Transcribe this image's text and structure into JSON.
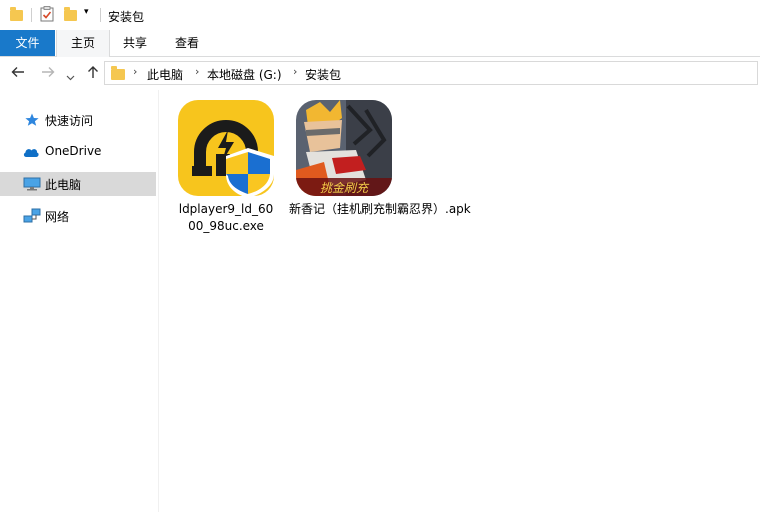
{
  "window": {
    "title": "安装包"
  },
  "ribbon": {
    "tabs": [
      "文件",
      "主页",
      "共享",
      "查看"
    ]
  },
  "address": {
    "crumbs": [
      "此电脑",
      "本地磁盘 (G:)",
      "安装包"
    ]
  },
  "sidebar": {
    "items": [
      {
        "label": "快速访问",
        "icon": "star-icon"
      },
      {
        "label": "OneDrive",
        "icon": "cloud-icon"
      },
      {
        "label": "此电脑",
        "icon": "computer-icon",
        "selected": true
      },
      {
        "label": "网络",
        "icon": "network-icon"
      }
    ]
  },
  "files": [
    {
      "name_line1": "ldplayer9_ld_60",
      "name_line2": "00_98uc.exe",
      "icon": "ldplayer-installer-icon"
    },
    {
      "name_line1": "新香记（挂机刷充制霸忍界）.apk",
      "name_line2": "",
      "icon": "naruto-game-apk-icon",
      "badge_text": "挑金刷充"
    }
  ],
  "colors": {
    "accent": "#1979ca",
    "folder": "#f5c750",
    "ld_yellow": "#f7c51d",
    "shield_blue": "#1a6fd1",
    "shield_yellow": "#f9c621"
  }
}
